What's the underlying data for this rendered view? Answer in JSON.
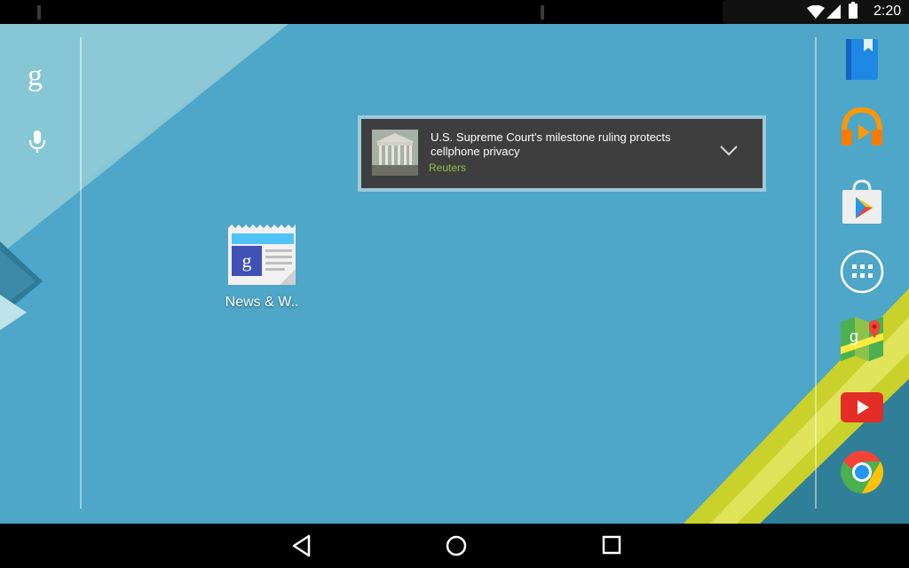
{
  "status_bar": {
    "time": "2:20",
    "icons": [
      "wifi-icon",
      "signal-icon",
      "battery-icon"
    ]
  },
  "search": {
    "logo": "g",
    "mic_icon": "mic-icon"
  },
  "news_widget": {
    "headline": "U.S. Supreme Court's milestone ruling protects cellphone privacy",
    "source": "Reuters",
    "source_color": "#8bc34a",
    "expand_icon": "chevron-down-icon"
  },
  "home_apps": [
    {
      "label": "News & W..",
      "icon": "news-weather-icon"
    }
  ],
  "dock": [
    {
      "icon": "play-books-icon"
    },
    {
      "icon": "play-music-icon"
    },
    {
      "icon": "play-store-icon"
    },
    {
      "icon": "app-drawer-icon"
    },
    {
      "icon": "maps-icon"
    },
    {
      "icon": "youtube-icon"
    },
    {
      "icon": "chrome-icon"
    }
  ],
  "nav": [
    "back-icon",
    "home-icon",
    "recents-icon"
  ],
  "colors": {
    "wallpaper": "#4ea6c8",
    "accent_yellow": "#c9d12a"
  }
}
